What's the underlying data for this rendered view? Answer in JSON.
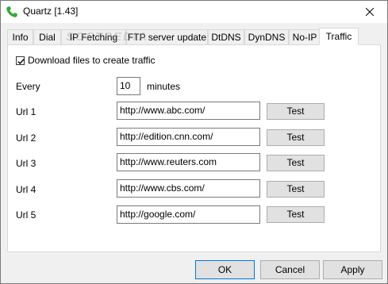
{
  "window": {
    "title": "Quartz [1.43]",
    "icon": "phone-icon",
    "close_glyph": "✕"
  },
  "tabs": [
    {
      "label": "Info",
      "active": false
    },
    {
      "label": "Dial",
      "active": false
    },
    {
      "label": "IP Fetching",
      "active": false
    },
    {
      "label": "FTP server update",
      "active": false
    },
    {
      "label": "DtDNS",
      "active": false
    },
    {
      "label": "DynDNS",
      "active": false
    },
    {
      "label": "No-IP",
      "active": false
    },
    {
      "label": "Traffic",
      "active": true
    }
  ],
  "watermark": "SOFTPEDIA",
  "traffic": {
    "download_label": "Download files to create traffic",
    "download_checked": true,
    "every_label": "Every",
    "every_value": "10",
    "minutes_label": "minutes",
    "urls": [
      {
        "label": "Url 1",
        "value": "http://www.abc.com/",
        "button": "Test"
      },
      {
        "label": "Url 2",
        "value": "http://edition.cnn.com/",
        "button": "Test"
      },
      {
        "label": "Url 3",
        "value": "http://www.reuters.com",
        "button": "Test"
      },
      {
        "label": "Url 4",
        "value": "http://www.cbs.com/",
        "button": "Test"
      },
      {
        "label": "Url 5",
        "value": "http://google.com/",
        "button": "Test"
      }
    ]
  },
  "buttons": {
    "ok": "OK",
    "cancel": "Cancel",
    "apply": "Apply"
  }
}
